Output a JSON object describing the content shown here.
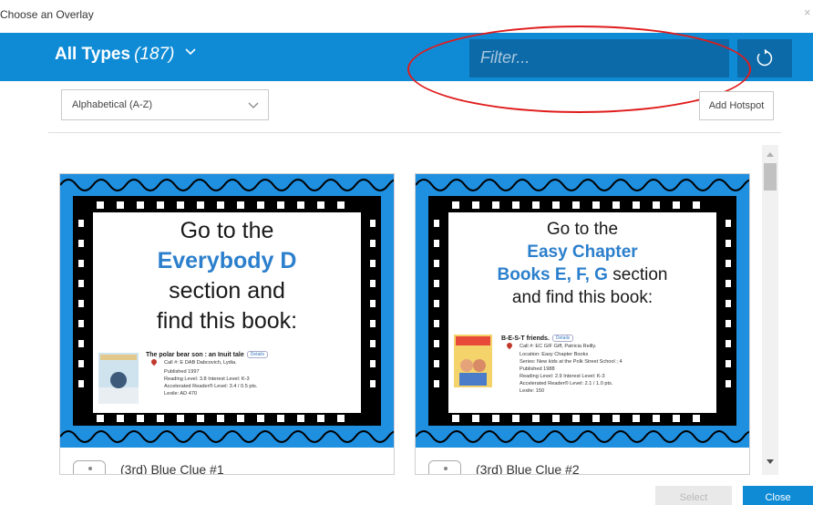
{
  "dialog": {
    "title": "Choose an Overlay",
    "close_glyph": "×"
  },
  "toolbar": {
    "types_label": "All Types",
    "types_count": "(187)",
    "filter_placeholder": "Filter...",
    "refresh_icon": "refresh-icon"
  },
  "controls": {
    "sort_value": "Alphabetical (A-Z)",
    "add_hotspot": "Add Hotspot"
  },
  "cards": [
    {
      "label": "(3rd) Blue Clue #1",
      "slide": {
        "line1": "Go to the",
        "highlight": "Everybody D",
        "line3": "section and",
        "line4": "find this book:",
        "book_title": "The polar bear son : an Inuit tale",
        "details": "Details",
        "call": "Call #: E DAB        Dabcovich, Lydia.",
        "published": "Published 1997",
        "reading": "Reading Level: 3.8   Interest Level: K-3",
        "ar": "Accelerated Reader® Level: 3.4 / 0.5 pts.",
        "lexile": "Lexile: AD 470"
      }
    },
    {
      "label": "(3rd) Blue Clue #2",
      "slide": {
        "line1": "Go to the",
        "highlight1": "Easy Chapter",
        "highlight2": "Books E, F, G",
        "line2_tail": " section",
        "line3": "and find this book:",
        "book_title": "B-E-S-T friends.",
        "details": "Details",
        "call": "Call #: EC GIF        Giff, Patricia Reilly.",
        "location": "Location: Easy Chapter Books",
        "series": "Series: New kids at the Polk Street School ; 4",
        "published": "Published 1988",
        "reading": "Reading Level: 2.9   Interest Level: K-3",
        "ar": "Accelerated Reader® Level: 2.1 / 1.0 pts.",
        "lexile": "Lexile: 150"
      }
    }
  ],
  "footer": {
    "select": "Select",
    "close": "Close"
  },
  "colors": {
    "brand_blue": "#0f8bd6",
    "filter_bg": "#0c6aa9",
    "annotation_red": "#e01b1b"
  }
}
